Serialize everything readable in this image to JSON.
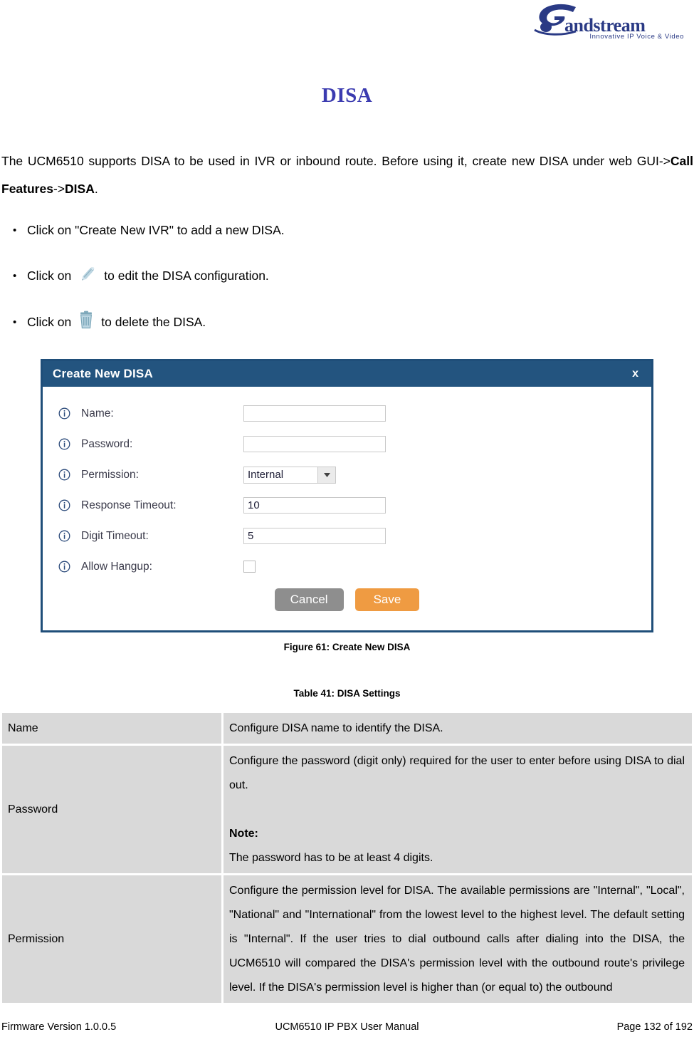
{
  "header": {
    "logo_text": "Grandstream",
    "logo_tagline": "Innovative IP Voice & Video"
  },
  "page_title": "DISA",
  "intro": {
    "prefix": "The UCM6510 supports DISA to be used in IVR or inbound route. Before using it, create new DISA under web GUI->",
    "bold1": "Call Features",
    "middle": "->",
    "bold2": "DISA",
    "suffix": "."
  },
  "bullets": [
    {
      "marker": "•",
      "text_before": "Click on \"Create New IVR\" to add a new DISA.",
      "icon": null,
      "text_after": ""
    },
    {
      "marker": "•",
      "text_before": "Click on",
      "icon": "pencil-icon",
      "text_after": "to edit the DISA configuration."
    },
    {
      "marker": "•",
      "text_before": "Click on",
      "icon": "trash-icon",
      "text_after": "to delete the DISA."
    }
  ],
  "dialog": {
    "title": "Create New DISA",
    "close_label": "x",
    "fields": [
      {
        "label": "Name:",
        "type": "text",
        "value": "",
        "info_icon": "info-icon"
      },
      {
        "label": "Password:",
        "type": "text",
        "value": "",
        "info_icon": "info-icon"
      },
      {
        "label": "Permission:",
        "type": "select",
        "value": "Internal",
        "info_icon": "info-icon"
      },
      {
        "label": "Response Timeout:",
        "type": "text",
        "value": "10",
        "info_icon": "info-icon"
      },
      {
        "label": "Digit Timeout:",
        "type": "text",
        "value": "5",
        "info_icon": "info-icon"
      },
      {
        "label": "Allow Hangup:",
        "type": "checkbox",
        "value": "",
        "info_icon": "info-icon"
      }
    ],
    "cancel_label": "Cancel",
    "save_label": "Save"
  },
  "figure_caption": "Figure 61: Create New DISA",
  "table_caption": "Table 41: DISA Settings",
  "settings_rows": [
    {
      "key": "Name",
      "desc": "Configure DISA name to identify the DISA.",
      "note_label": "",
      "note_text": ""
    },
    {
      "key": "Password",
      "desc": "Configure the password (digit only) required for the user to enter before using DISA to dial out.",
      "note_label": "Note:",
      "note_text": "The password has to be at least 4 digits."
    },
    {
      "key": "Permission",
      "desc": "Configure the permission level for DISA. The available permissions are \"Internal\", \"Local\", \"National\" and \"International\" from the lowest level to the highest level. The default setting is \"Internal\". If the user tries to dial outbound calls after dialing into the DISA, the UCM6510 will compared the DISA's permission level with the outbound route's privilege level. If the DISA's permission level is higher than (or equal to) the outbound",
      "note_label": "",
      "note_text": ""
    }
  ],
  "footer": {
    "left": "Firmware Version 1.0.0.5",
    "center": "UCM6510 IP PBX User Manual",
    "right": "Page 132 of 192"
  },
  "colors": {
    "title_blue": "#3b3bb0",
    "dialog_header": "#23547f",
    "dialog_border": "#1f4e79",
    "save_orange": "#ef9b42",
    "cancel_gray": "#8e8e8e",
    "table_cell": "#d9d9d9",
    "icon_blue": "#a8c6d6"
  }
}
